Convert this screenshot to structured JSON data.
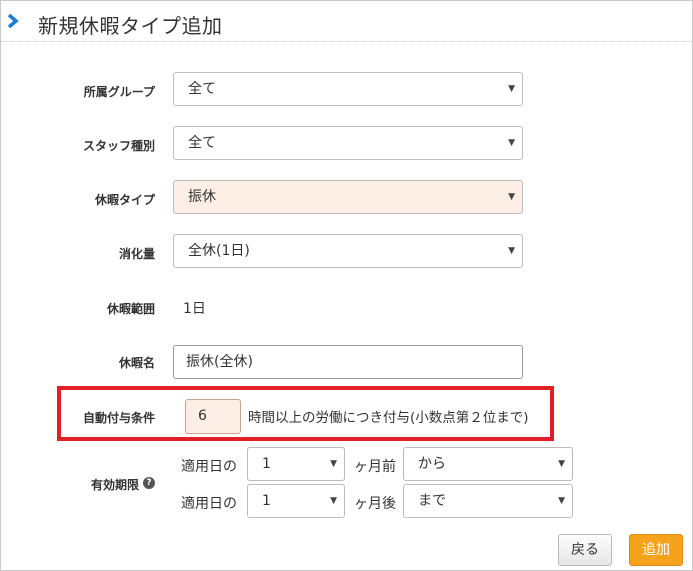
{
  "header": {
    "title": "新規休暇タイプ追加"
  },
  "form": {
    "group": {
      "label": "所属グループ",
      "value": "全て"
    },
    "staff_type": {
      "label": "スタッフ種別",
      "value": "全て"
    },
    "leave_type": {
      "label": "休暇タイプ",
      "value": "振休"
    },
    "consumption": {
      "label": "消化量",
      "value": "全休(1日)"
    },
    "range": {
      "label": "休暇範囲",
      "value": "1日"
    },
    "name": {
      "label": "休暇名",
      "value": "振休(全休)"
    },
    "auto_grant": {
      "label": "自動付与条件",
      "hours": "6",
      "text": "時間以上の労働につき付与(小数点第２位まで)"
    },
    "validity": {
      "label": "有効期限",
      "help_icon": "?",
      "row1": {
        "prefix": "適用日の",
        "months": "1",
        "unit": "ヶ月前",
        "direction": "から"
      },
      "row2": {
        "prefix": "適用日の",
        "months": "1",
        "unit": "ヶ月後",
        "direction": "まで"
      }
    }
  },
  "buttons": {
    "back": "戻る",
    "add": "追加"
  },
  "colors": {
    "accent_chevron": "#1e7bd7",
    "highlight_red": "#e21f26",
    "add_button": "#f7a21d",
    "field_highlight": "#fdeee6"
  }
}
